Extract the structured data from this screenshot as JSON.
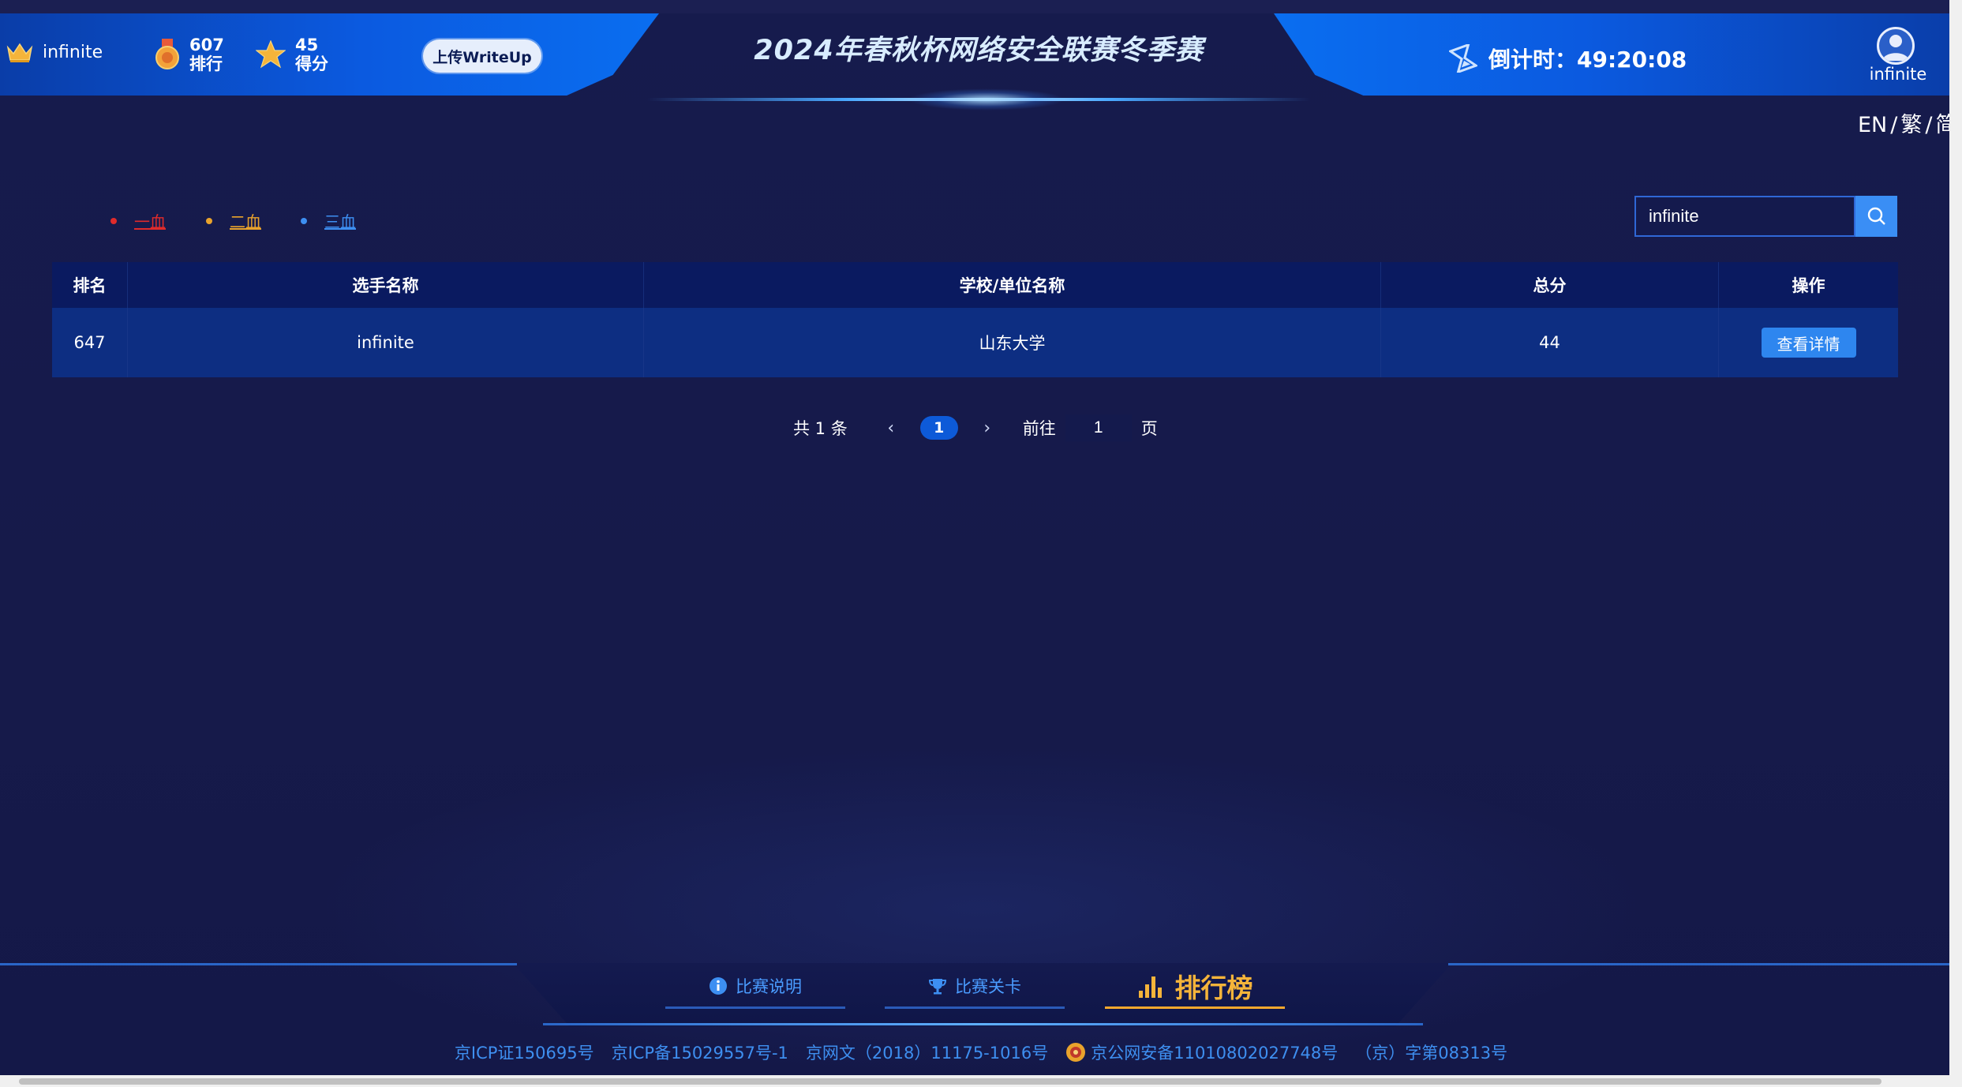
{
  "header": {
    "title": "2024年春秋杯网络安全联赛冬季赛",
    "user_name": "infinite",
    "rank_value": "607",
    "rank_label": "排行",
    "score_value": "45",
    "score_label": "得分",
    "upload_label": "上传WriteUp",
    "countdown": "倒计时：49:20:08",
    "avatar_name": "infinite",
    "lang": [
      "EN",
      "繁",
      "简"
    ]
  },
  "legend": {
    "first": "一血",
    "second": "二血",
    "third": "三血",
    "colors": {
      "first": "#e02b2b",
      "second": "#e9a32c",
      "third": "#3d8ff2"
    }
  },
  "search": {
    "value": "infinite"
  },
  "table": {
    "headers": [
      "排名",
      "选手名称",
      "学校/单位名称",
      "总分",
      "操作"
    ],
    "rows": [
      {
        "rank": "647",
        "name": "infinite",
        "school": "山东大学",
        "score": "44",
        "action": "查看详情"
      }
    ]
  },
  "pagination": {
    "total": "共 1 条",
    "current": "1",
    "goto_label": "前往",
    "goto_value": "1",
    "page_label": "页"
  },
  "bottom_nav": {
    "items": [
      "比赛说明",
      "比赛关卡",
      "排行榜"
    ]
  },
  "footer": {
    "items": [
      "京ICP证150695号",
      "京ICP备15029557号-1",
      "京网文（2018）11175-1016号",
      "京公网安备11010802027748号",
      "（京）字第08313号"
    ]
  },
  "colors": {
    "background": "#15194a",
    "accent": "#2e86ef",
    "active_nav": "#f5b43a"
  }
}
